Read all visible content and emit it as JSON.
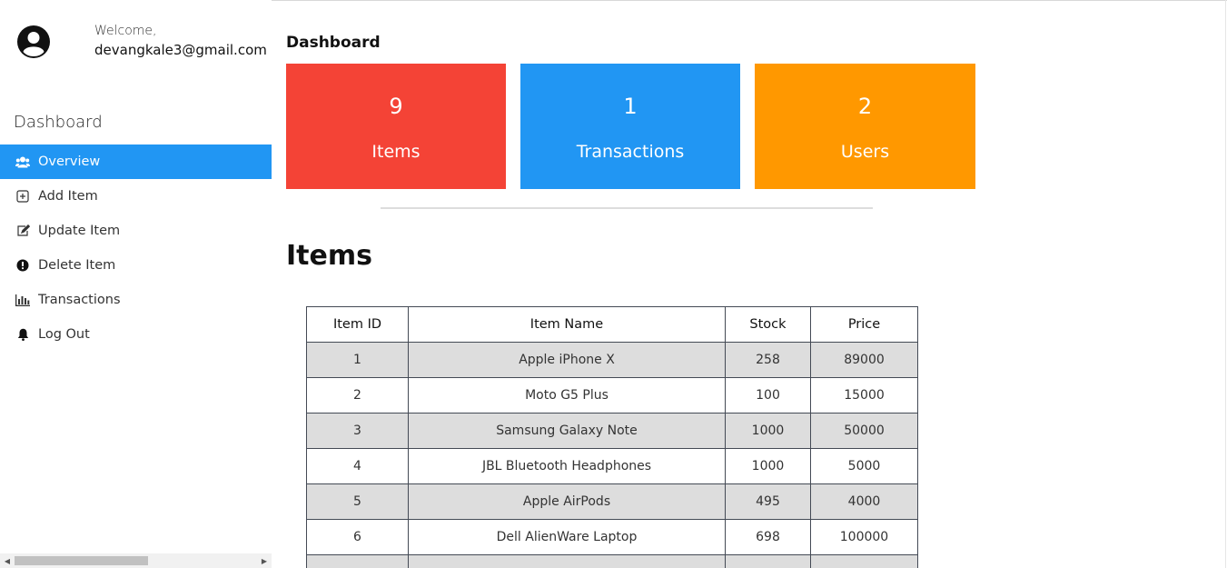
{
  "user": {
    "welcome": "Welcome,",
    "email": "devangkale3@gmail.com"
  },
  "sidebar": {
    "title": "Dashboard",
    "items": [
      {
        "label": "Overview",
        "icon": "users-icon",
        "active": true
      },
      {
        "label": "Add Item",
        "icon": "plus-square-icon",
        "active": false
      },
      {
        "label": "Update Item",
        "icon": "edit-icon",
        "active": false
      },
      {
        "label": "Delete Item",
        "icon": "exclamation-circle-icon",
        "active": false
      },
      {
        "label": "Transactions",
        "icon": "bar-chart-icon",
        "active": false
      },
      {
        "label": "Log Out",
        "icon": "bell-icon",
        "active": false
      }
    ]
  },
  "main": {
    "title": "Dashboard",
    "cards": [
      {
        "value": "9",
        "label": "Items",
        "color": "#F44336"
      },
      {
        "value": "1",
        "label": "Transactions",
        "color": "#2196F3"
      },
      {
        "value": "2",
        "label": "Users",
        "color": "#FF9800"
      }
    ],
    "items_heading": "Items",
    "table": {
      "headers": [
        "Item ID",
        "Item Name",
        "Stock",
        "Price"
      ],
      "rows": [
        [
          "1",
          "Apple iPhone X",
          "258",
          "89000"
        ],
        [
          "2",
          "Moto G5 Plus",
          "100",
          "15000"
        ],
        [
          "3",
          "Samsung Galaxy Note",
          "1000",
          "50000"
        ],
        [
          "4",
          "JBL Bluetooth Headphones",
          "1000",
          "5000"
        ],
        [
          "5",
          "Apple AirPods",
          "495",
          "4000"
        ],
        [
          "6",
          "Dell AlienWare Laptop",
          "698",
          "100000"
        ],
        [
          "",
          "",
          "",
          ""
        ]
      ]
    }
  },
  "colors": {
    "accent": "#2196F3",
    "red": "#F44336",
    "orange": "#FF9800",
    "row_shade": "#DDDDDD"
  }
}
